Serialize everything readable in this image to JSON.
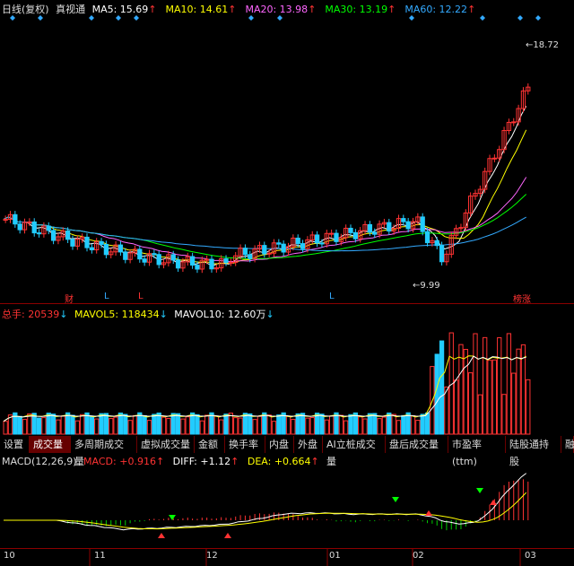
{
  "header": {
    "period": "日线(复权)",
    "indicator": "真视通",
    "ma": [
      {
        "label": "MA5:",
        "value": "15.69",
        "color": "#ffffff"
      },
      {
        "label": "MA10:",
        "value": "14.61",
        "color": "#ffff00"
      },
      {
        "label": "MA20:",
        "value": "13.98",
        "color": "#ff66ff"
      },
      {
        "label": "MA30:",
        "value": "13.19",
        "color": "#00ff00"
      },
      {
        "label": "MA60:",
        "value": "12.22",
        "color": "#33aaff"
      }
    ]
  },
  "price": {
    "high_label": "18.72",
    "low_label": "9.99",
    "markers": [
      {
        "text": "财",
        "color": "#ff3333"
      },
      {
        "text": "L",
        "color": "#33aaff"
      },
      {
        "text": "L",
        "color": "#ff3333"
      },
      {
        "text": "L",
        "color": "#33aaff"
      },
      {
        "text": "榜涨",
        "color": "#ff3333"
      }
    ]
  },
  "volume": {
    "label": "总手:",
    "value": "20539",
    "mavol5_label": "MAVOL5:",
    "mavol5": "118434",
    "mavol10_label": "MAVOL10:",
    "mavol10": "12.60万"
  },
  "tabs": [
    "设置",
    "成交量",
    "多周期成交量",
    "虚拟成交量",
    "金额",
    "换手率",
    "内盘",
    "外盘",
    "AI立桩成交量",
    "盘后成交量",
    "市盈率(ttm)",
    "陆股通持股",
    "融"
  ],
  "active_tab": 1,
  "macd": {
    "name": "MACD(12,26,9)",
    "macd_label": "MACD:",
    "macd": "+0.916",
    "diff_label": "DIFF:",
    "diff": "+1.12",
    "dea_label": "DEA:",
    "dea": "+0.664"
  },
  "xaxis": [
    "10",
    "11",
    "12",
    "01",
    "02",
    "03"
  ],
  "colors": {
    "up": "#ff3333",
    "down": "#22ccff",
    "ma5": "#ffffff",
    "ma10": "#ffff00",
    "ma20": "#ff66ff",
    "ma30": "#00ff00",
    "ma60": "#33aaff"
  }
}
